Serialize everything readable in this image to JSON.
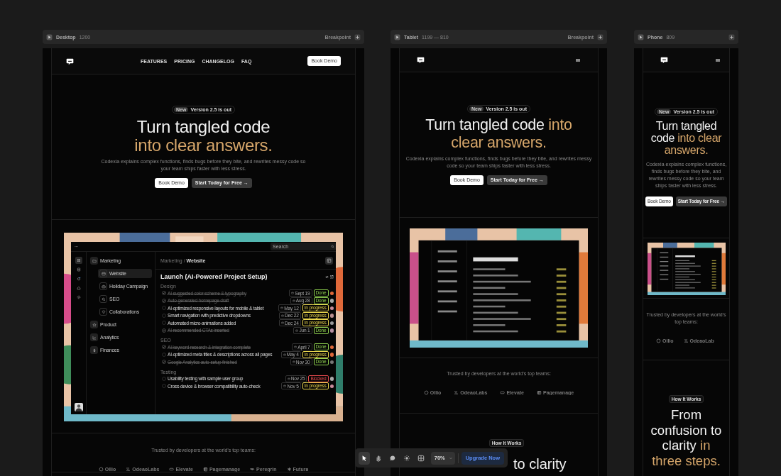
{
  "frames": [
    {
      "kind": "desktop",
      "name": "Desktop",
      "size": "1200",
      "breakpoint": "Breakpoint",
      "nav": {
        "links": [
          "FEATURES",
          "PRICING",
          "CHANGELOG",
          "FAQ"
        ],
        "button": "Book Demo"
      },
      "hero": {
        "badge_tag": "New",
        "badge_text": "Version 2.5 is out",
        "headline": "Turn tangled code",
        "headline_accent": "into clear answers.",
        "body": "Codexia explains complex functions, finds bugs before they bite, and rewrites messy code so your team ships faster with less stress.",
        "buttons": [
          {
            "label": "Book Demo",
            "kind": "primary"
          },
          {
            "label": "Start Today for Free →",
            "kind": "secondary"
          }
        ]
      },
      "mockup": {
        "kind": "app",
        "search": {
          "placeholder": "Search"
        },
        "rail": [
          {
            "selected": true
          },
          {
            "selected": false
          },
          {
            "selected": false
          },
          {
            "selected": false
          },
          {
            "selected": false
          }
        ],
        "sidebar": {
          "items": [
            {
              "label": "Marketing",
              "selected": false,
              "children": [
                {
                  "label": "Website",
                  "selected": true
                },
                {
                  "label": "Holiday Campaign",
                  "selected": false
                },
                {
                  "label": "SEO",
                  "selected": false
                },
                {
                  "label": "Collaborations",
                  "selected": false
                }
              ]
            },
            {
              "label": "Product",
              "selected": false
            },
            {
              "label": "Analytics",
              "selected": false
            },
            {
              "label": "Finances",
              "selected": false
            }
          ]
        },
        "breadcrumb": {
          "parent": "Marketing",
          "separator": "/",
          "current": "Website"
        },
        "title": "Launch (AI-Powered Project Setup)",
        "sections": [
          {
            "label": "Design",
            "tasks": [
              {
                "title": "AI-suggested color scheme & typography",
                "checked": true,
                "date": "Sept 19",
                "status": "Done",
                "color": "#8fd14f"
              },
              {
                "title": "Auto-generated homepage draft",
                "checked": true,
                "date": "Aug 28",
                "status": "Done",
                "color": "#8fd14f"
              },
              {
                "title": "AI-optimized responsive layouts for mobile & tablet",
                "checked": false,
                "date": "May 12",
                "status": "In progress",
                "color": "#e8d44d"
              },
              {
                "title": "Smart navigation with predictive dropdowns",
                "checked": false,
                "date": "Dec 22",
                "status": "In progress",
                "color": "#e8d44d"
              },
              {
                "title": "Automated micro-animations added",
                "checked": false,
                "date": "Dec 24",
                "status": "In progress",
                "color": "#e8d44d"
              },
              {
                "title": "AI-recommended CTAs inserted",
                "checked": true,
                "date": "Jun 1",
                "status": "Done",
                "color": "#8fd14f"
              }
            ]
          },
          {
            "label": "SEO",
            "tasks": [
              {
                "title": "AI keyword research & integration complete",
                "checked": true,
                "date": "April 7",
                "status": "Done",
                "color": "#8fd14f"
              },
              {
                "title": "AI-optimized meta titles & descriptions across all pages",
                "checked": false,
                "date": "May 4",
                "status": "In progress",
                "color": "#e8d44d"
              },
              {
                "title": "Google Analytics auto-setup finished",
                "checked": true,
                "date": "Nov 30",
                "status": "Done",
                "color": "#8fd14f"
              }
            ]
          },
          {
            "label": "Testing",
            "tasks": [
              {
                "title": "Usability testing with sample user group",
                "checked": false,
                "date": "Nov 25",
                "status": "Blocked",
                "color": "#e5484d"
              },
              {
                "title": "Cross-device & browser compatibility auto-check",
                "checked": false,
                "date": "Nov 5",
                "status": "In progress",
                "color": "#e8d44d"
              }
            ]
          }
        ]
      },
      "trusted": {
        "caption": "Trusted by developers at the world’s top teams:",
        "logos": [
          "Ollio",
          "OdeaoLabs",
          "Elevate",
          "Pagemanage",
          "Peregrin",
          "Futura"
        ]
      }
    },
    {
      "kind": "tablet",
      "name": "Tablet",
      "size": "1199 — 810",
      "breakpoint": "Breakpoint",
      "hero": {
        "badge_tag": "New",
        "badge_text": "Version 2.5 is out",
        "headline": "Turn tangled code",
        "headline_accent": "into clear answers.",
        "body": "Codexia explains complex functions, finds bugs before they bite, and rewrites messy code so your team ships faster with less stress.",
        "buttons": [
          {
            "label": "Book Demo",
            "kind": "primary"
          },
          {
            "label": "Start Today for Free →",
            "kind": "secondary"
          }
        ]
      },
      "mockup": {
        "kind": "preview"
      },
      "trusted": {
        "caption": "Trusted by developers at the world’s top teams:",
        "logos": [
          "Ollio",
          "OdeaoLabs",
          "Elevate",
          "Pagemanage"
        ]
      },
      "how": {
        "tag": "How It Works",
        "headline": "to clarity"
      }
    },
    {
      "kind": "phone",
      "name": "Phone",
      "size": "809",
      "hero": {
        "badge_tag": "New",
        "badge_text": "Version 2.5 is out",
        "headline": "Turn tangled code",
        "headline_accent": "into clear answers.",
        "body": "Codexia explains complex functions, finds bugs before they bite, and rewrites messy code so your team ships faster with less stress.",
        "buttons": [
          {
            "label": "Book Demo",
            "kind": "primary"
          },
          {
            "label": "Start Today for Free →",
            "kind": "secondary"
          }
        ]
      },
      "mockup": {
        "kind": "preview"
      },
      "trusted": {
        "caption": "Trusted by developers at the world’s top teams:",
        "logos": [
          "Ollio",
          "OdeaoLab"
        ]
      },
      "how": {
        "tag": "How It Works",
        "headline": "From confusion to clarity",
        "headline_accent": "in three steps."
      }
    }
  ],
  "toolbar": {
    "tools": [
      {
        "kind": "pointer",
        "selected": true
      },
      {
        "kind": "hand",
        "selected": false
      },
      {
        "kind": "comment",
        "selected": false
      },
      {
        "kind": "sun",
        "selected": false
      },
      {
        "kind": "grid",
        "selected": false
      }
    ],
    "zoom": "70%",
    "upgrade": "Upgrade Now"
  }
}
